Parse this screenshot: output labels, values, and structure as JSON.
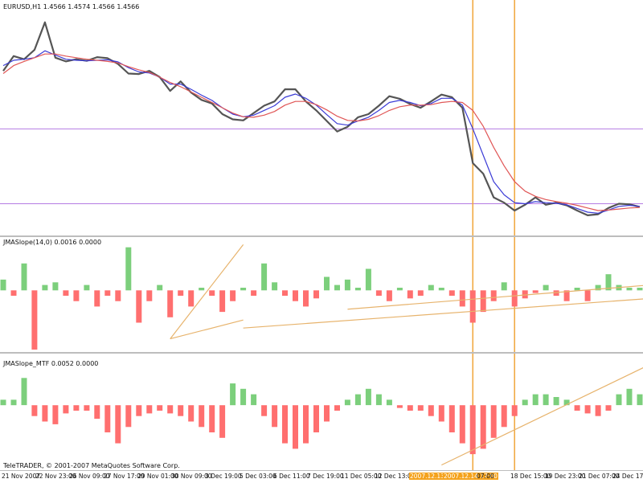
{
  "chart_title": "EURUSD,H1  1.4566 1.4574 1.4566 1.4566",
  "panel2_title": "JMASlope(14,0) 0.0016 0.0000",
  "panel3_title": "JMASlope_MTF 0.0052 0.0000",
  "copyright": "TeleTRADER, © 2001-2007 MetaQuotes Software Corp.",
  "colors": {
    "price": "#555555",
    "fast_ma": "#3b3bd6",
    "slow_ma": "#e05656",
    "hline": "#b57be3",
    "vline": "#f0a53a",
    "pos": "#7ccf7c",
    "neg": "#ff6f6f",
    "trend": "#e7b36c"
  },
  "x_ticks": [
    {
      "label": "21 Nov 2007"
    },
    {
      "label": "22 Nov 23:00"
    },
    {
      "label": "26 Nov 09:00"
    },
    {
      "label": "27 Nov 17:00"
    },
    {
      "label": "29 Nov 01:00"
    },
    {
      "label": "30 Nov 09:00"
    },
    {
      "label": "3 Dec 19:00"
    },
    {
      "label": "5 Dec 03:00"
    },
    {
      "label": "6 Dec 11:00"
    },
    {
      "label": "7 Dec 19:00"
    },
    {
      "label": "11 Dec 05:00"
    },
    {
      "label": "12 Dec 13:00"
    },
    {
      "label": "2007.12.13 17:00"
    },
    {
      "label": "2007.12.14 17:00"
    },
    {
      "label": "07:00"
    },
    {
      "label": "18 Dec 15:00"
    },
    {
      "label": "19 Dec 23:00"
    },
    {
      "label": "21 Dec 07:00"
    },
    {
      "label": "24 Dec 17"
    }
  ],
  "chart_data": [
    {
      "type": "line",
      "title": "EURUSD,H1",
      "series": [
        {
          "name": "EURUSD,H1",
          "values": [
            1.472,
            1.4748,
            1.4742,
            1.476,
            1.4812,
            1.4745,
            1.4738,
            1.4742,
            1.4739,
            1.4746,
            1.4744,
            1.4733,
            1.4715,
            1.4714,
            1.472,
            1.4708,
            1.4682,
            1.47,
            1.4679,
            1.4665,
            1.4658,
            1.4638,
            1.4628,
            1.4626,
            1.464,
            1.4654,
            1.4662,
            1.4685,
            1.4685,
            1.4662,
            1.4645,
            1.4625,
            1.4605,
            1.4614,
            1.4632,
            1.4638,
            1.4654,
            1.4672,
            1.4667,
            1.4657,
            1.465,
            1.4662,
            1.4675,
            1.467,
            1.465,
            1.4545,
            1.4525,
            1.448,
            1.447,
            1.4455,
            1.4466,
            1.448,
            1.4466,
            1.447,
            1.4465,
            1.4455,
            1.4446,
            1.4448,
            1.446,
            1.4468,
            1.4467,
            1.4462
          ]
        },
        {
          "name": "fast MA",
          "values": [
            1.473,
            1.474,
            1.4742,
            1.4745,
            1.4758,
            1.475,
            1.4742,
            1.474,
            1.4739,
            1.474,
            1.4741,
            1.4737,
            1.4726,
            1.4718,
            1.4716,
            1.4708,
            1.4695,
            1.4695,
            1.4685,
            1.4674,
            1.4664,
            1.465,
            1.4638,
            1.4633,
            1.4636,
            1.4645,
            1.4654,
            1.467,
            1.4676,
            1.4668,
            1.4655,
            1.4637,
            1.462,
            1.4617,
            1.4625,
            1.4632,
            1.4645,
            1.466,
            1.4664,
            1.466,
            1.4654,
            1.4658,
            1.4668,
            1.4668,
            1.4655,
            1.461,
            1.456,
            1.451,
            1.4485,
            1.447,
            1.4468,
            1.4472,
            1.447,
            1.4469,
            1.4466,
            1.4459,
            1.4452,
            1.445,
            1.4456,
            1.4463,
            1.4465,
            1.4463
          ]
        },
        {
          "name": "slow MA",
          "values": [
            1.4715,
            1.473,
            1.4738,
            1.4745,
            1.4752,
            1.4752,
            1.4748,
            1.4745,
            1.4742,
            1.474,
            1.4738,
            1.4735,
            1.4728,
            1.4722,
            1.4717,
            1.4708,
            1.4698,
            1.469,
            1.468,
            1.467,
            1.466,
            1.465,
            1.464,
            1.4633,
            1.4632,
            1.4636,
            1.4643,
            1.4655,
            1.4662,
            1.4662,
            1.4656,
            1.4646,
            1.4634,
            1.4626,
            1.4625,
            1.4628,
            1.4635,
            1.4645,
            1.4652,
            1.4655,
            1.4655,
            1.4656,
            1.466,
            1.4662,
            1.466,
            1.4645,
            1.4615,
            1.4575,
            1.454,
            1.451,
            1.4492,
            1.4482,
            1.4476,
            1.4472,
            1.4469,
            1.4465,
            1.446,
            1.4455,
            1.4456,
            1.4458,
            1.446,
            1.4461
          ]
        }
      ],
      "hlines": [
        1.461,
        1.4468
      ],
      "ylim": [
        1.442,
        1.483
      ]
    },
    {
      "type": "bar",
      "title": "JMASlope(14,0)",
      "values": [
        0.0004,
        -0.0002,
        0.001,
        -0.0022,
        0.0002,
        0.0003,
        -0.0002,
        -0.0004,
        0.0002,
        -0.0006,
        -0.0002,
        -0.0004,
        0.0016,
        -0.0012,
        -0.0004,
        0.0002,
        -0.001,
        -0.0002,
        -0.0006,
        0.0001,
        -0.0002,
        -0.0008,
        -0.0004,
        0.0001,
        -0.0002,
        0.001,
        0.0003,
        -0.0002,
        -0.0004,
        -0.0006,
        -0.0003,
        0.0005,
        0.0002,
        0.0004,
        0.0001,
        0.0008,
        -0.0002,
        -0.0004,
        0.0001,
        -0.0003,
        -0.0002,
        0.0002,
        0.0001,
        -0.0002,
        -0.0006,
        -0.0012,
        -0.0008,
        -0.0004,
        0.0003,
        -0.0006,
        -0.0003,
        -0.0001,
        0.0002,
        -0.0002,
        -0.0004,
        0.0001,
        -0.0004,
        0.0002,
        0.0006,
        0.0002,
        0.0001,
        0.0001
      ],
      "trendlines": [
        [
          16,
          -0.0018,
          23,
          0.0017
        ],
        [
          16,
          -0.0018,
          23,
          -0.0011
        ],
        [
          23,
          -0.0014,
          62,
          -0.0003
        ],
        [
          33,
          -0.0007,
          62,
          0.0002
        ]
      ],
      "ylim": [
        -0.0022,
        0.0018
      ]
    },
    {
      "type": "bar",
      "title": "JMASlope_MTF",
      "values": [
        0.0002,
        0.0002,
        0.001,
        -0.0004,
        -0.0006,
        -0.0007,
        -0.0003,
        -0.0002,
        -0.0002,
        -0.0005,
        -0.001,
        -0.0014,
        -0.0008,
        -0.0004,
        -0.0003,
        -0.0002,
        -0.0003,
        -0.0004,
        -0.0006,
        -0.0008,
        -0.001,
        -0.0012,
        0.0008,
        0.0006,
        0.0004,
        -0.0004,
        -0.0008,
        -0.0014,
        -0.0016,
        -0.0014,
        -0.001,
        -0.0006,
        -0.0002,
        0.0002,
        0.0004,
        0.0006,
        0.0004,
        0.0002,
        -0.0001,
        -0.0002,
        -0.0002,
        -0.0004,
        -0.0006,
        -0.001,
        -0.0014,
        -0.0018,
        -0.0016,
        -0.0012,
        -0.0008,
        -0.0004,
        0.0002,
        0.0004,
        0.0004,
        0.0003,
        0.0002,
        -0.0002,
        -0.0003,
        -0.0004,
        -0.0002,
        0.0004,
        0.0006,
        0.0004
      ],
      "trendlines": [
        [
          42,
          -0.0022,
          62,
          0.0015
        ]
      ],
      "ylim": [
        -0.0023,
        0.0016
      ]
    }
  ]
}
